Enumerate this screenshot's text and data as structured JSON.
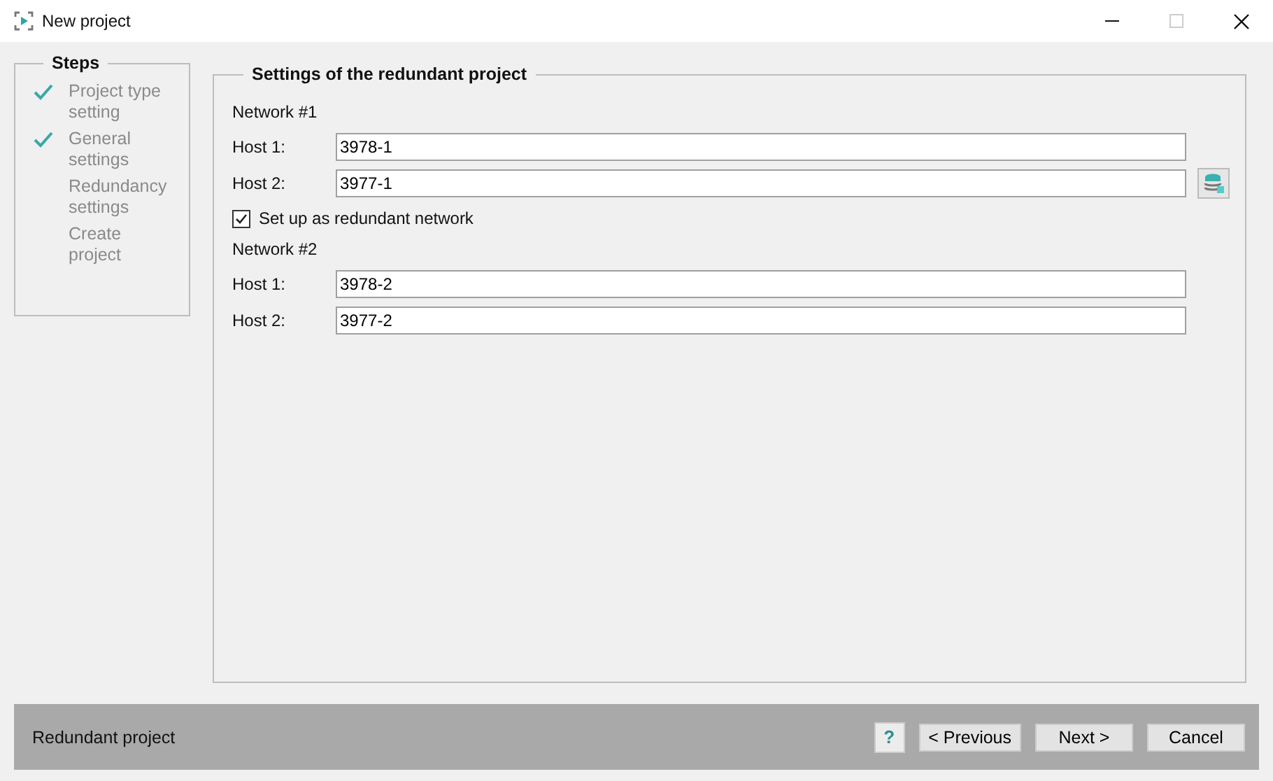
{
  "window": {
    "title": "New project",
    "maximize_disabled": true
  },
  "steps": {
    "title": "Steps",
    "items": [
      {
        "label": "Project type setting",
        "done": true
      },
      {
        "label": "General settings",
        "done": true
      },
      {
        "label": "Redundancy settings",
        "done": false
      },
      {
        "label": "Create project",
        "done": false
      }
    ]
  },
  "settings": {
    "title": "Settings of the redundant project",
    "sections": [
      {
        "kind": "network",
        "title": "Network #1",
        "hosts": [
          {
            "label": "Host 1:",
            "value": "3978-1",
            "db_button": false
          },
          {
            "label": "Host 2:",
            "value": "3977-1",
            "db_button": true
          }
        ]
      },
      {
        "kind": "checkbox",
        "label": "Set up as redundant network",
        "checked": true
      },
      {
        "kind": "network",
        "title": "Network #2",
        "hosts": [
          {
            "label": "Host 1:",
            "value": "3978-2",
            "db_button": false
          },
          {
            "label": "Host 2:",
            "value": "3977-2",
            "db_button": false
          }
        ]
      }
    ]
  },
  "footer": {
    "title": "Redundant project",
    "help": "?",
    "buttons": [
      "< Previous",
      "Next >",
      "Cancel"
    ]
  }
}
